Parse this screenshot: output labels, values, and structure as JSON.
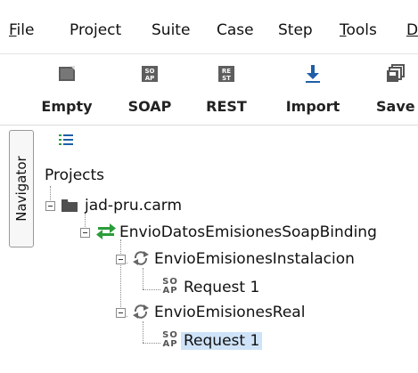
{
  "menu": {
    "file": {
      "mnemonic": "F",
      "rest": "ile"
    },
    "project": "Project",
    "suite": "Suite",
    "case": "Case",
    "step": "Step",
    "tools": {
      "mnemonic": "T",
      "rest": "ools"
    },
    "cut": "D"
  },
  "toolbar": {
    "empty": {
      "label": "Empty",
      "icon": "empty-project-icon"
    },
    "soap": {
      "label": "SOAP",
      "icon": "soap-project-icon",
      "glyph_top": "SO",
      "glyph_bottom": "AP"
    },
    "rest": {
      "label": "REST",
      "icon": "rest-project-icon",
      "glyph_top": "RE",
      "glyph_bottom": "ST"
    },
    "import": {
      "label": "Import",
      "icon": "import-icon",
      "color": "#1f5ea8"
    },
    "save": {
      "label": "Save",
      "icon": "save-all-icon"
    }
  },
  "side_tab": {
    "label": "Navigator"
  },
  "navigator": {
    "root_label": "Projects",
    "project": {
      "name": "jad-pru.carm",
      "icon": "folder-icon"
    },
    "interface": {
      "name": "EnvioDatosEmisionesSoapBinding",
      "icon": "interface-swap-icon",
      "color": "#2a9d3a"
    },
    "operations": [
      {
        "name": "EnvioEmisionesInstalacion",
        "icon": "operation-cycle-icon",
        "requests": [
          {
            "name": "Request 1",
            "icon": "soap-request-icon",
            "selected": false
          }
        ]
      },
      {
        "name": "EnvioEmisionesReal",
        "icon": "operation-cycle-icon",
        "requests": [
          {
            "name": "Request 1",
            "icon": "soap-request-icon",
            "selected": true
          }
        ]
      }
    ],
    "request_glyph": {
      "top": "SO",
      "bottom": "AP"
    },
    "selection_color": "#cfe3f8"
  }
}
